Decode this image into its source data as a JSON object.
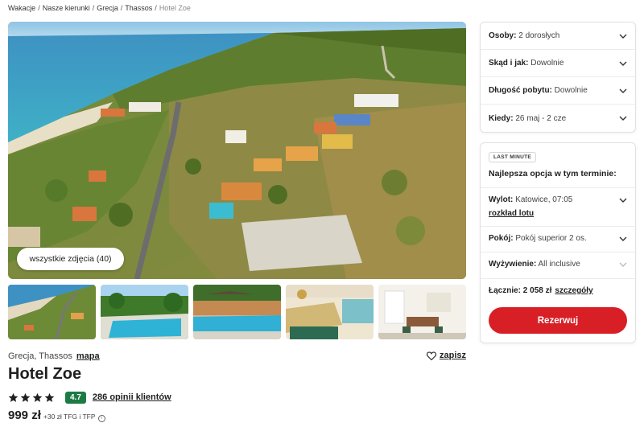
{
  "breadcrumb": {
    "items": [
      "Wakacje",
      "Nasze kierunki",
      "Grecja",
      "Thassos"
    ],
    "current": "Hotel Zoe",
    "separator": "/"
  },
  "gallery": {
    "all_photos_label": "wszystkie zdjęcia (40)",
    "thumbnails": [
      "aerial-view",
      "pool-with-garden",
      "pool-with-umbrellas",
      "bar-interior",
      "room-interior"
    ]
  },
  "hotel": {
    "location": "Grecja, Thassos",
    "map_label": "mapa",
    "save_label": "zapisz",
    "name": "Hotel Zoe",
    "stars": 4,
    "score": "4.7",
    "reviews_label": "286 opinii klientów",
    "price": "999 zł",
    "price_extra": "+30 zł TFG i TFP",
    "info_icon": "ⓘ"
  },
  "filters": [
    {
      "label": "Osoby:",
      "value": "2 dorosłych"
    },
    {
      "label": "Skąd i jak:",
      "value": "Dowolnie"
    },
    {
      "label": "Długość pobytu:",
      "value": "Dowolnie"
    },
    {
      "label": "Kiedy:",
      "value": "26 maj - 2 cze"
    }
  ],
  "offer": {
    "badge": "LAST MINUTE",
    "headline": "Najlepsza opcja w tym terminie:",
    "flight_label": "Wylot:",
    "flight_value": "Katowice, 07:05",
    "flight_link": "rozkład lotu",
    "room_label": "Pokój:",
    "room_value": "Pokój superior 2 os.",
    "board_label": "Wyżywienie:",
    "board_value": "All inclusive",
    "total_label": "Łącznie:",
    "total_value": "2 058 zł",
    "details_label": "szczegóły",
    "book_label": "Rezerwuj"
  },
  "colors": {
    "accent_red": "#d81f26",
    "score_green": "#1e7a45"
  }
}
